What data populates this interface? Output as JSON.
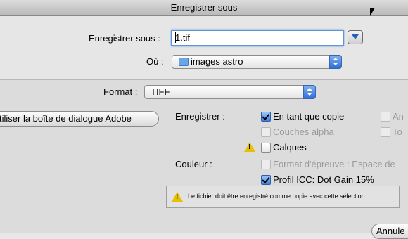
{
  "window": {
    "title": "Enregistrer sous"
  },
  "save": {
    "name_label": "Enregistrer sous :",
    "name_value": "1.tif",
    "where_label": "Où :",
    "where_value": "images astro",
    "format_label": "Format :",
    "format_value": "TIFF"
  },
  "dialog_button": "tiliser la boîte de dialogue Adobe",
  "options": {
    "save_label": "Enregistrer :",
    "as_copy": "En tant que copie",
    "alpha": "Couches alpha",
    "layers": "Calques",
    "col3_a": "An",
    "col3_b": "To",
    "color_label": "Couleur :",
    "proof": "Format d'épreuve : Espace de",
    "icc": "Profil ICC:  Dot Gain 15%"
  },
  "checks": {
    "as_copy": true,
    "alpha": false,
    "layers": false,
    "col3_a": false,
    "col3_b": false,
    "proof": false,
    "icc": true
  },
  "warning_message": "Le fichier doit être enregistré comme copie avec cette sélection.",
  "cancel_button": "Annule",
  "icons": [
    "disclosure-triangle-icon",
    "folder-icon",
    "popup-arrows-icon",
    "warning-icon",
    "mouse-cursor-icon"
  ]
}
